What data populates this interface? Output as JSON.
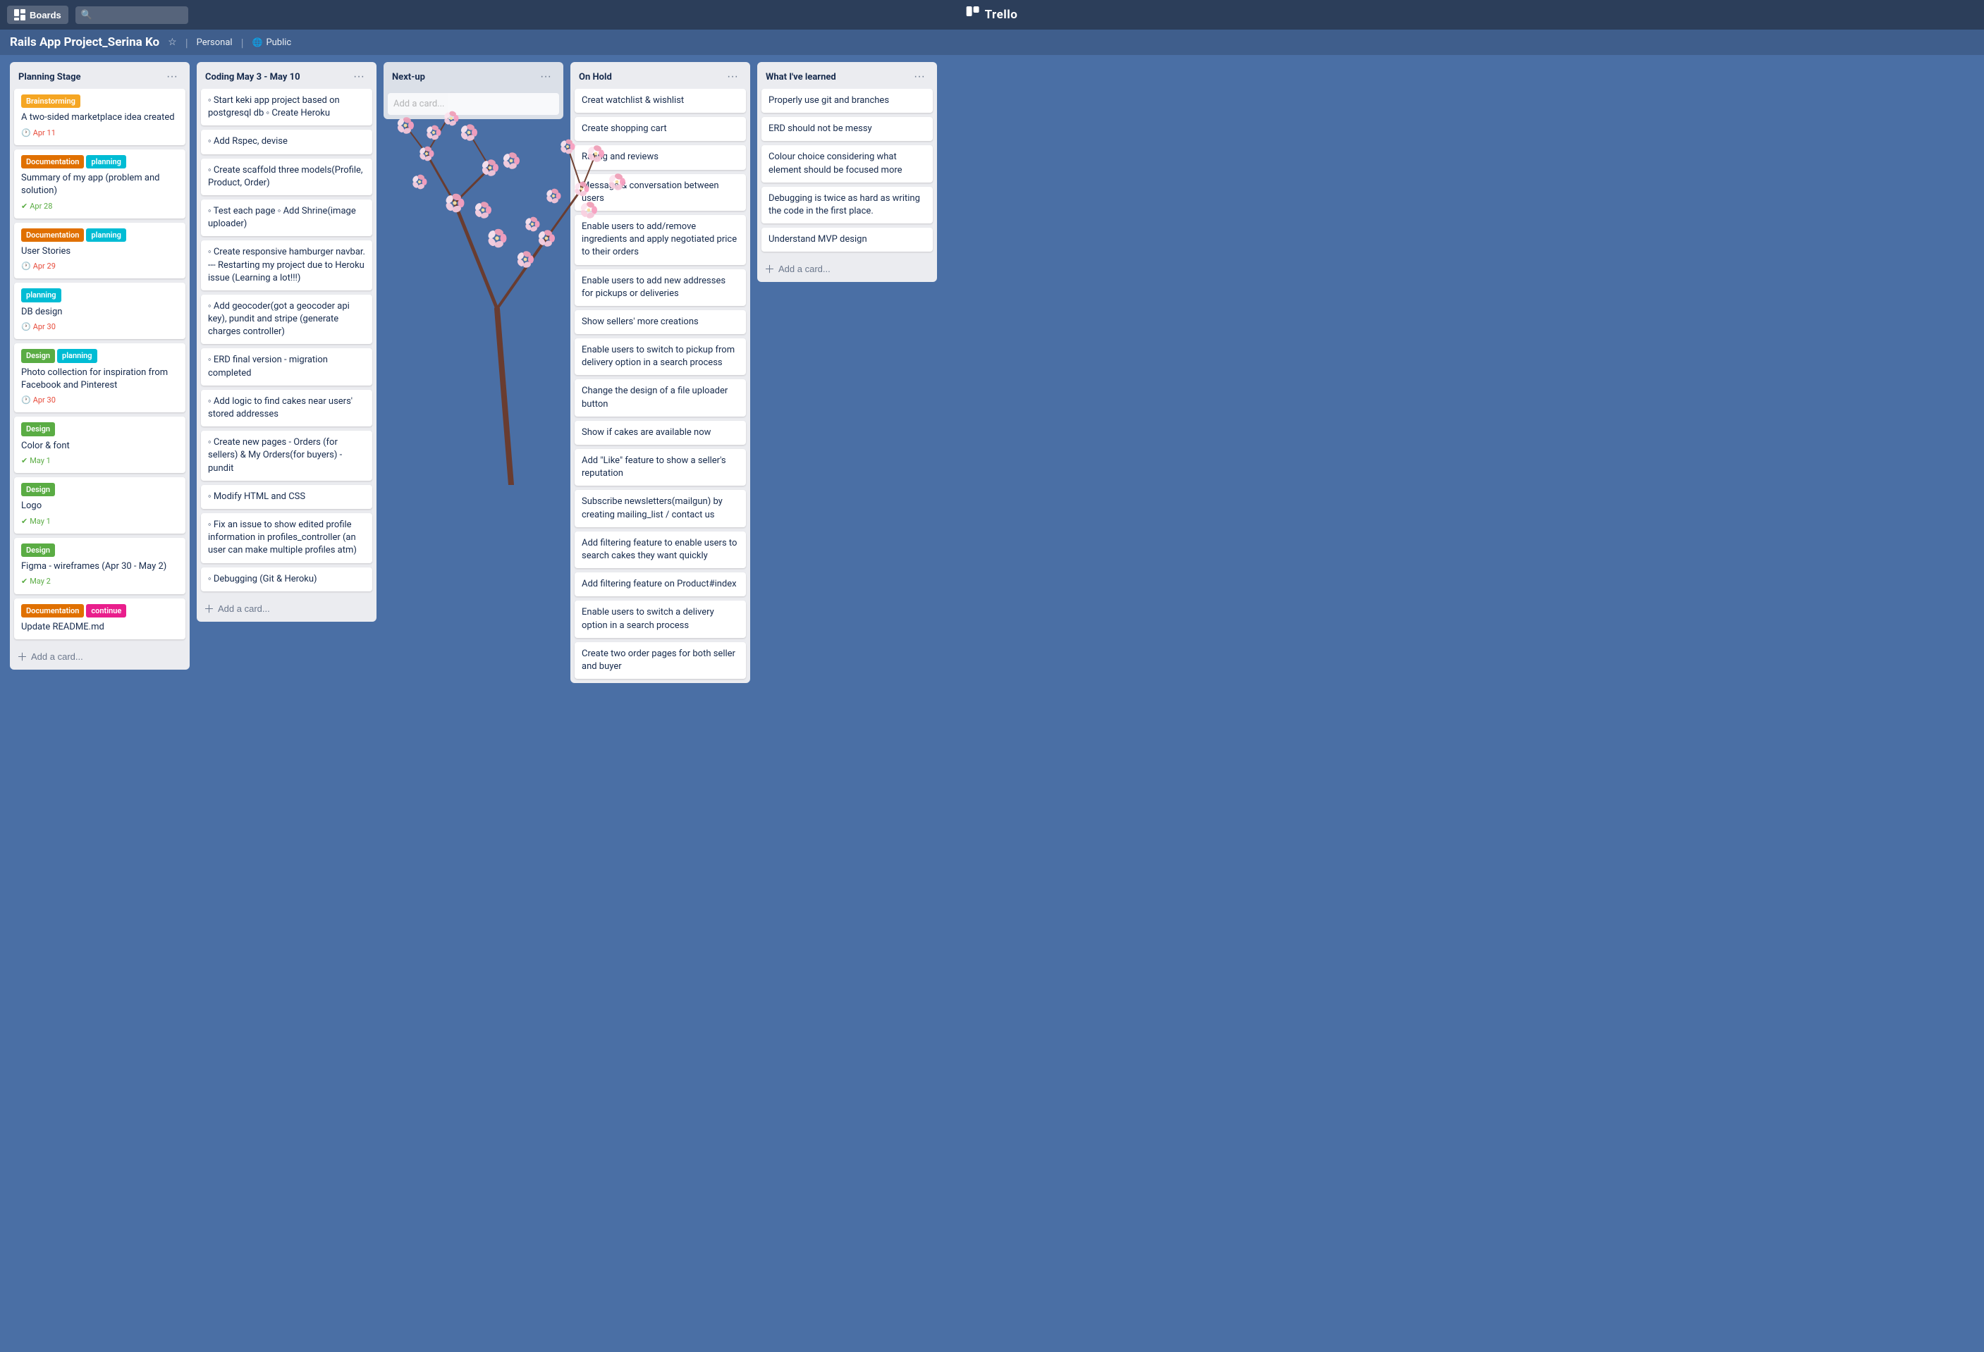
{
  "topbar": {
    "boards_label": "Boards",
    "search_placeholder": "",
    "logo_text": "Trello",
    "logo_icon": "🗂"
  },
  "board_header": {
    "title": "Rails App Project_Serina Ko",
    "personal_label": "Personal",
    "visibility_label": "Public"
  },
  "columns": [
    {
      "id": "planning",
      "title": "Planning Stage",
      "add_card_label": "Add a card...",
      "cards": [
        {
          "id": "c1",
          "labels": [
            {
              "text": "Brainstorming",
              "color": "label-yellow"
            }
          ],
          "text": "A two-sided marketplace idea created",
          "badge": {
            "icon": "🕐",
            "text": "Apr 11",
            "color": "badge-red"
          }
        },
        {
          "id": "c2",
          "labels": [
            {
              "text": "Documentation",
              "color": "label-orange"
            },
            {
              "text": "planning",
              "color": "label-cyan"
            }
          ],
          "text": "Summary of my app (problem and solution)",
          "badge": {
            "icon": "✔",
            "text": "Apr 28",
            "color": "badge-green"
          }
        },
        {
          "id": "c3",
          "labels": [
            {
              "text": "Documentation",
              "color": "label-orange"
            },
            {
              "text": "planning",
              "color": "label-cyan"
            }
          ],
          "text": "User Stories",
          "badge": {
            "icon": "🕐",
            "text": "Apr 29",
            "color": "badge-red"
          }
        },
        {
          "id": "c4",
          "labels": [
            {
              "text": "planning",
              "color": "label-cyan"
            }
          ],
          "text": "DB design",
          "badge": {
            "icon": "🕐",
            "text": "Apr 30",
            "color": "badge-red"
          }
        },
        {
          "id": "c5",
          "labels": [
            {
              "text": "Design",
              "color": "label-green"
            },
            {
              "text": "planning",
              "color": "label-cyan"
            }
          ],
          "text": "Photo collection for inspiration from Facebook and Pinterest",
          "badge": {
            "icon": "🕐",
            "text": "Apr 30",
            "color": "badge-red"
          }
        },
        {
          "id": "c6",
          "labels": [
            {
              "text": "Design",
              "color": "label-green"
            }
          ],
          "text": "Color & font",
          "badge": {
            "icon": "✔",
            "text": "May 1",
            "color": "badge-green"
          }
        },
        {
          "id": "c7",
          "labels": [
            {
              "text": "Design",
              "color": "label-green"
            }
          ],
          "text": "Logo",
          "badge": {
            "icon": "✔",
            "text": "May 1",
            "color": "badge-green"
          }
        },
        {
          "id": "c8",
          "labels": [
            {
              "text": "Design",
              "color": "label-green"
            }
          ],
          "text": "Figma - wireframes (Apr 30 - May 2)",
          "badge": {
            "icon": "✔",
            "text": "May 2",
            "color": "badge-green"
          }
        },
        {
          "id": "c9",
          "labels": [
            {
              "text": "Documentation",
              "color": "label-orange"
            },
            {
              "text": "continue",
              "color": "label-pink"
            }
          ],
          "text": "Update README.md",
          "badge": null
        }
      ]
    },
    {
      "id": "coding",
      "title": "Coding May 3 - May 10",
      "add_card_label": "Add a card...",
      "cards": [
        {
          "id": "cod1",
          "labels": [],
          "text": "◦ Start keki app project based on postgresql db ◦ Create Heroku",
          "badge": null
        },
        {
          "id": "cod2",
          "labels": [],
          "text": "◦ Add Rspec, devise",
          "badge": null
        },
        {
          "id": "cod3",
          "labels": [],
          "text": "◦ Create scaffold three models(Profile, Product, Order)",
          "badge": null
        },
        {
          "id": "cod4",
          "labels": [],
          "text": "◦ Test each page ◦ Add Shrine(image uploader)",
          "badge": null
        },
        {
          "id": "cod5",
          "labels": [],
          "text": "◦ Create responsive hamburger navbar. --- Restarting my project due to Heroku issue (Learning a lot!!!)",
          "badge": null
        },
        {
          "id": "cod6",
          "labels": [],
          "text": "◦ Add geocoder(got a geocoder api key), pundit and stripe (generate charges controller)",
          "badge": null
        },
        {
          "id": "cod7",
          "labels": [],
          "text": "◦ ERD final version - migration completed",
          "badge": null
        },
        {
          "id": "cod8",
          "labels": [],
          "text": "◦ Add logic to find cakes near users' stored addresses",
          "badge": null
        },
        {
          "id": "cod9",
          "labels": [],
          "text": "◦ Create new pages - Orders (for sellers) & My Orders(for buyers) - pundit",
          "badge": null
        },
        {
          "id": "cod10",
          "labels": [],
          "text": "◦ Modify HTML and CSS",
          "badge": null
        },
        {
          "id": "cod11",
          "labels": [],
          "text": "◦ Fix an issue to show edited profile information in profiles_controller (an user can make multiple profiles atm)",
          "badge": null
        },
        {
          "id": "cod12",
          "labels": [],
          "text": "◦ Debugging (Git & Heroku)",
          "badge": null
        }
      ]
    },
    {
      "id": "nextup",
      "title": "Next-up",
      "add_card_label": "Add a card...",
      "cards": []
    },
    {
      "id": "onhold",
      "title": "On Hold",
      "add_card_label": null,
      "cards": [
        {
          "id": "oh1",
          "labels": [],
          "text": "Creat watchlist & wishlist",
          "badge": null
        },
        {
          "id": "oh2",
          "labels": [],
          "text": "Create shopping cart",
          "badge": null
        },
        {
          "id": "oh3",
          "labels": [],
          "text": "Rating and reviews",
          "badge": null
        },
        {
          "id": "oh4",
          "labels": [],
          "text": "Message & conversation between users",
          "badge": null
        },
        {
          "id": "oh5",
          "labels": [],
          "text": "Enable users to add/remove ingredients and apply negotiated price to their orders",
          "badge": null
        },
        {
          "id": "oh6",
          "labels": [],
          "text": "Enable users to add new addresses for pickups or deliveries",
          "badge": null
        },
        {
          "id": "oh7",
          "labels": [],
          "text": "Show sellers' more creations",
          "badge": null
        },
        {
          "id": "oh8",
          "labels": [],
          "text": "Enable users to switch to pickup from delivery option in a search process",
          "badge": null
        },
        {
          "id": "oh9",
          "labels": [],
          "text": "Change the design of a file uploader button",
          "badge": null
        },
        {
          "id": "oh10",
          "labels": [],
          "text": "Show if cakes are available now",
          "badge": null
        },
        {
          "id": "oh11",
          "labels": [],
          "text": "Add \"Like\" feature to show a seller's reputation",
          "badge": null
        },
        {
          "id": "oh12",
          "labels": [],
          "text": "Subscribe newsletters(mailgun) by creating mailing_list / contact us",
          "badge": null
        },
        {
          "id": "oh13",
          "labels": [],
          "text": "Add filtering feature to enable users to search cakes they want quickly",
          "badge": null
        },
        {
          "id": "oh14",
          "labels": [],
          "text": "Add filtering feature on Product#index",
          "badge": null
        },
        {
          "id": "oh15",
          "labels": [],
          "text": "Enable users to switch a delivery option in a search process",
          "badge": null
        },
        {
          "id": "oh16",
          "labels": [],
          "text": "Create two order pages for both seller and buyer",
          "badge": null
        }
      ]
    },
    {
      "id": "learned",
      "title": "What I've learned",
      "add_card_label": "Add a card...",
      "cards": [
        {
          "id": "l1",
          "labels": [],
          "text": "Properly use git and branches",
          "badge": null
        },
        {
          "id": "l2",
          "labels": [],
          "text": "ERD should not be messy",
          "badge": null
        },
        {
          "id": "l3",
          "labels": [],
          "text": "Colour choice considering what element should be focused more",
          "badge": null
        },
        {
          "id": "l4",
          "labels": [],
          "text": "Debugging is twice as hard as writing the code in the first place.",
          "badge": null
        },
        {
          "id": "l5",
          "labels": [],
          "text": "Understand MVP design",
          "badge": null
        }
      ]
    }
  ]
}
